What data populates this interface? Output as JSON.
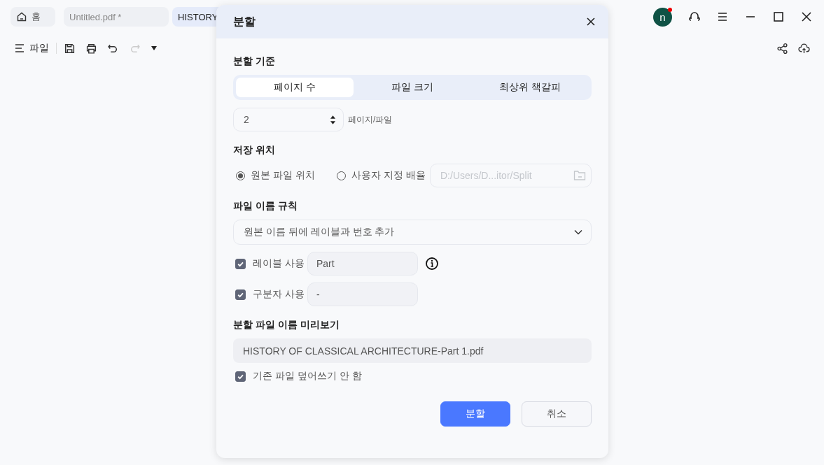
{
  "tabs": [
    {
      "label": "홈",
      "kind": "home",
      "selected": false
    },
    {
      "label": "Untitled.pdf *",
      "kind": "doc",
      "selected": false
    },
    {
      "label": "HISTORY",
      "kind": "doc",
      "selected": true
    }
  ],
  "avatar": {
    "initial": "n",
    "notification": true
  },
  "toolbar": {
    "file_menu": "파일"
  },
  "dialog": {
    "title": "분할",
    "split_by": {
      "heading": "분할 기준",
      "options": [
        {
          "label": "페이지 수",
          "selected": true
        },
        {
          "label": "파일 크기",
          "selected": false
        },
        {
          "label": "최상위 책갈피",
          "selected": false
        }
      ],
      "count": "2",
      "unit": "페이지/파일"
    },
    "save_location": {
      "heading": "저장 위치",
      "options": [
        {
          "label": "원본 파일 위치",
          "selected": true
        },
        {
          "label": "사용자 지정 배율",
          "selected": false
        }
      ],
      "path": {
        "placeholder": "D:/Users/D...itor/Split"
      }
    },
    "naming": {
      "heading": "파일 이름 규칙",
      "rule": "원본 이름 뒤에 레이블과 번호 추가",
      "options": [
        {
          "label": "레이블 사용",
          "checked": true,
          "value": "Part",
          "info": true
        },
        {
          "label": "구분자 사용",
          "checked": true,
          "value": "-"
        }
      ]
    },
    "preview": {
      "heading": "분할 파일 이름 미리보기",
      "value": "HISTORY OF CLASSICAL ARCHITECTURE-Part 1.pdf"
    },
    "no_overwrite": {
      "label": "기존 파일 덮어쓰기 안 함",
      "checked": true
    },
    "buttons": [
      {
        "label": "분할",
        "kind": "primary"
      },
      {
        "label": "취소",
        "kind": "secondary"
      }
    ]
  }
}
